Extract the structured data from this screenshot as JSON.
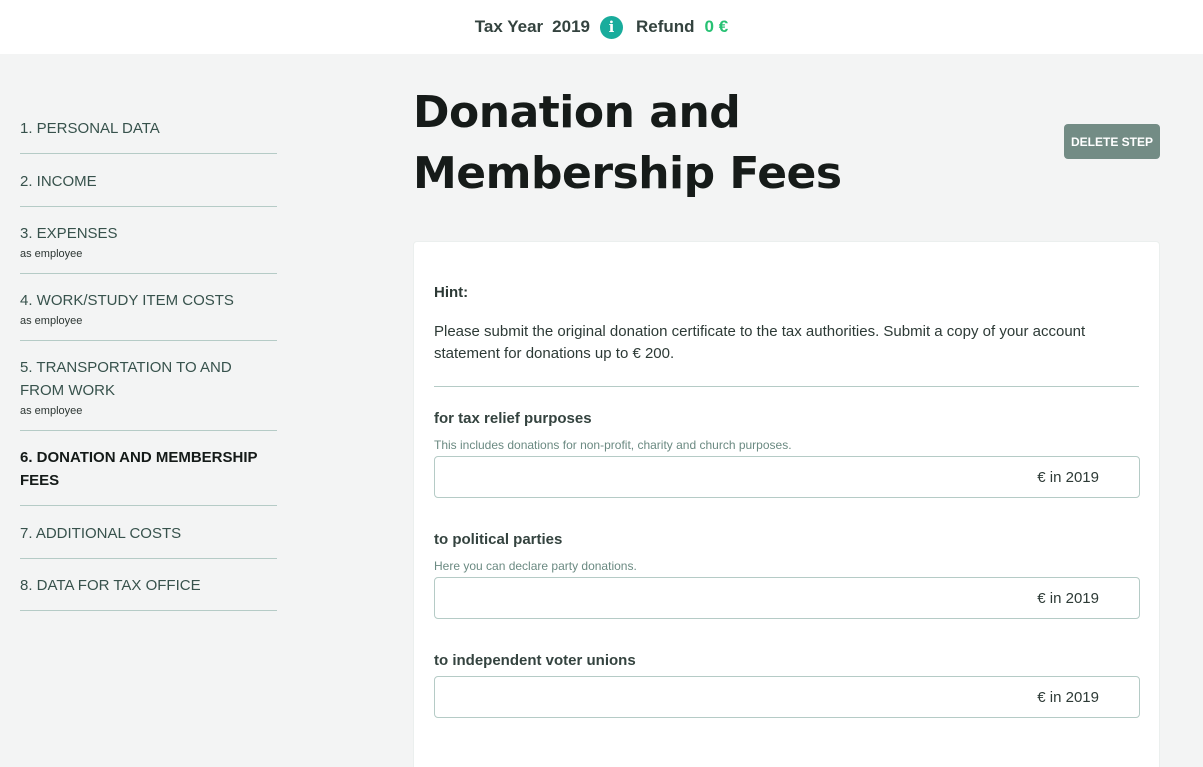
{
  "topbar": {
    "tax_year_label": "Tax Year",
    "tax_year_value": "2019",
    "info_icon": "i",
    "refund_label": "Refund",
    "refund_value": "0 €"
  },
  "sidebar": {
    "items": [
      {
        "label": "1. PERSONAL DATA",
        "sub": ""
      },
      {
        "label": "2. INCOME",
        "sub": ""
      },
      {
        "label": "3. EXPENSES",
        "sub": "as employee"
      },
      {
        "label": "4. WORK/STUDY ITEM COSTS",
        "sub": "as employee"
      },
      {
        "label": "5. TRANSPORTATION TO AND FROM WORK",
        "sub": "as employee"
      },
      {
        "label": "6. DONATION AND MEMBERSHIP FEES",
        "sub": ""
      },
      {
        "label": "7. ADDITIONAL COSTS",
        "sub": ""
      },
      {
        "label": "8. DATA FOR TAX OFFICE",
        "sub": ""
      }
    ]
  },
  "main": {
    "title": "Donation and Membership Fees",
    "delete_label": "DELETE STEP",
    "hint_title": "Hint:",
    "hint_text": "Please submit the original donation certificate to the tax authorities. Submit a copy of your account statement for donations up to € 200.",
    "fields": [
      {
        "label": "for tax relief purposes",
        "help": "This includes donations for non-profit, charity and church purposes.",
        "suffix": "€ in 2019"
      },
      {
        "label": "to political parties",
        "help": "Here you can declare party donations.",
        "suffix": "€ in 2019"
      },
      {
        "label": "to independent voter unions",
        "help": "",
        "suffix": "€ in 2019"
      }
    ]
  },
  "colors": {
    "accent": "#19ac9c",
    "refund": "#27c173",
    "delete_button": "#738c85"
  }
}
